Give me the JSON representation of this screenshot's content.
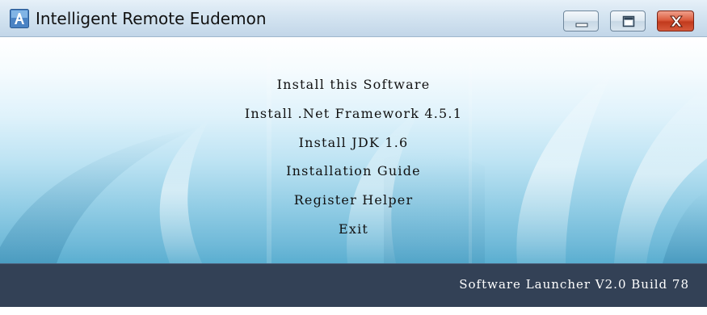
{
  "window": {
    "title": "Intelligent Remote Eudemon",
    "icon": "app-icon",
    "controls": [
      "minimize-icon",
      "maximize-icon",
      "close-icon"
    ]
  },
  "menu": {
    "items": [
      {
        "label": "Install this Software"
      },
      {
        "label": "Install .Net Framework 4.5.1"
      },
      {
        "label": "Install JDK 1.6"
      },
      {
        "label": "Installation Guide"
      },
      {
        "label": "Register Helper"
      },
      {
        "label": "Exit"
      }
    ]
  },
  "footer": {
    "version": "Software Launcher V2.0 Build 78"
  },
  "colors": {
    "footer_bg": "#334156",
    "close_button": "#c23a1d",
    "background_top": "#ffffff",
    "background_bottom": "#5aaed0"
  }
}
